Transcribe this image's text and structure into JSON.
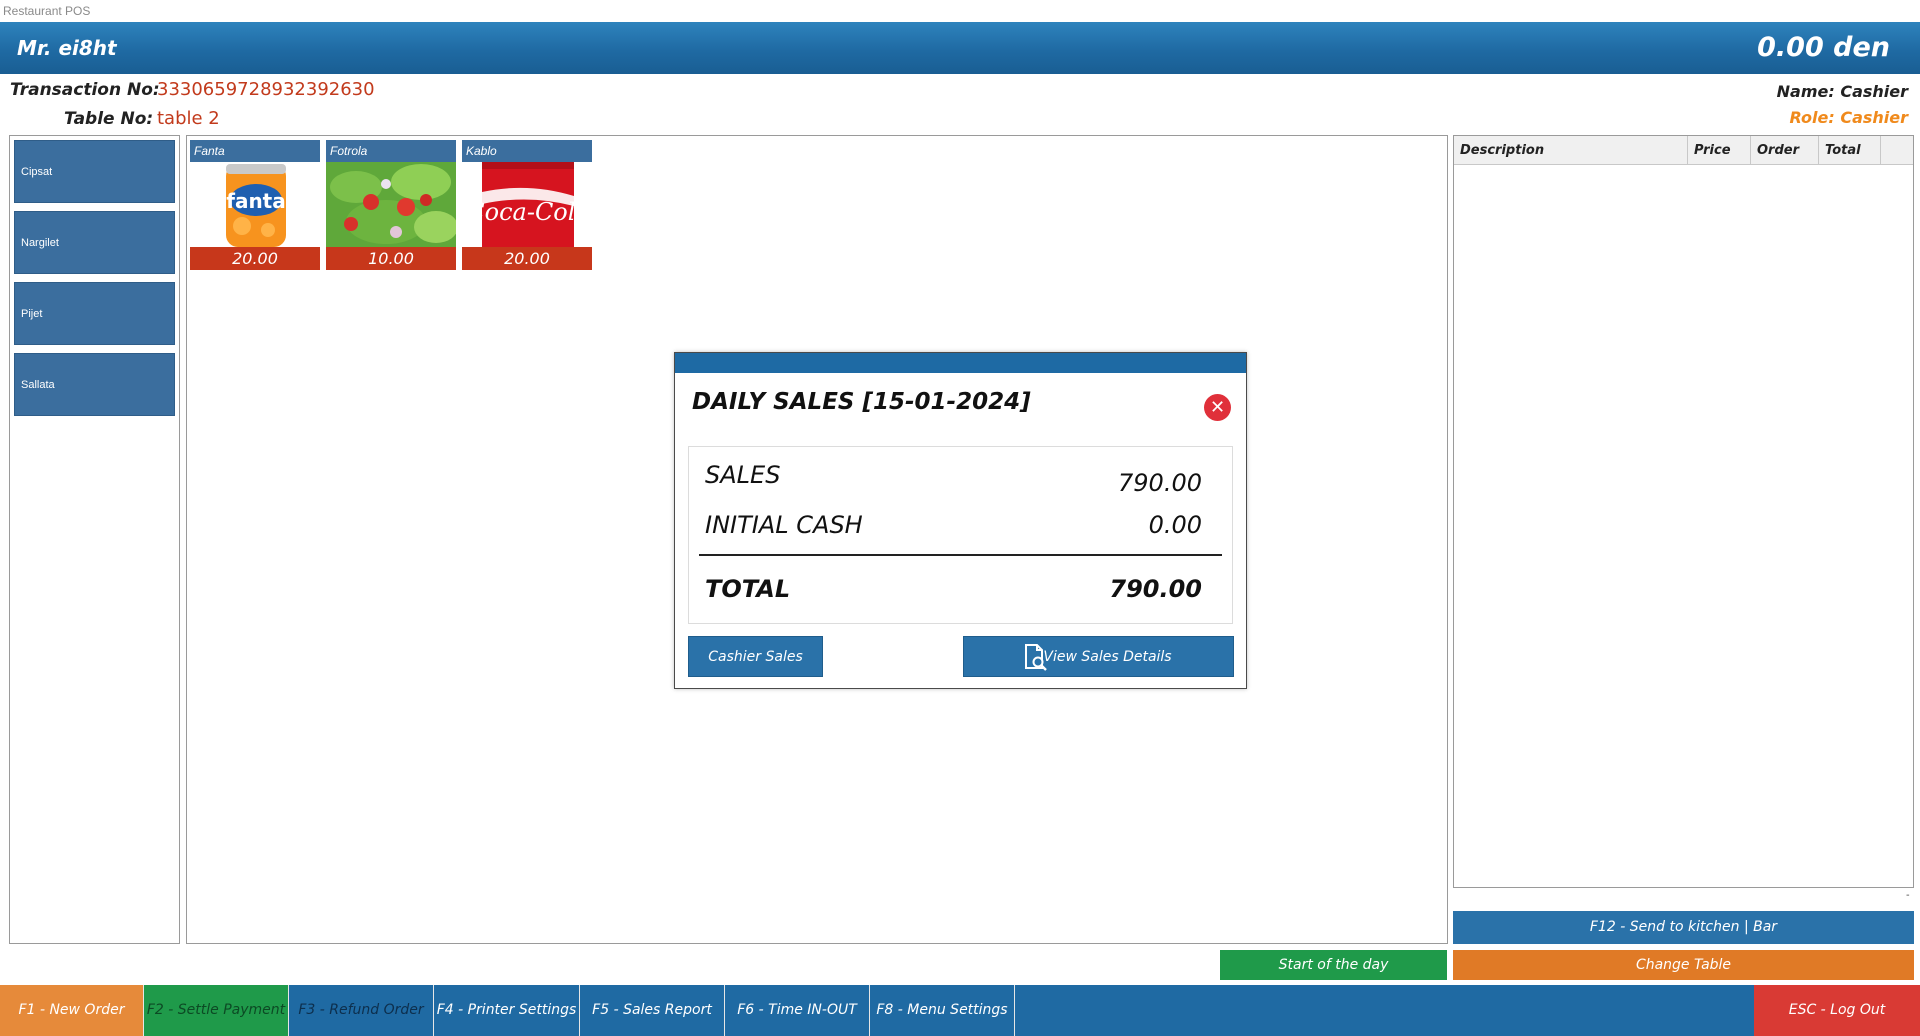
{
  "window": {
    "title": "Restaurant POS"
  },
  "header": {
    "user": "Mr. ei8ht",
    "balance": "0.00  den"
  },
  "transaction": {
    "transaction_label": "Transaction No:",
    "transaction_value": "3330659728932392630",
    "table_label": "Table No:",
    "table_value": "table 2",
    "name": "Name: Cashier",
    "role": "Role: Cashier"
  },
  "colors": {
    "accent": "#1f6aa3",
    "price_red": "#c7371b",
    "green": "#1f9a4a",
    "orange": "#e07a26",
    "logout_red": "#d93a34"
  },
  "categories": [
    {
      "label": "Cipsat"
    },
    {
      "label": "Nargilet"
    },
    {
      "label": "Pijet"
    },
    {
      "label": "Sallata"
    }
  ],
  "products": [
    {
      "name": "Fanta",
      "price": "20.00",
      "image": "fanta-can-image"
    },
    {
      "name": "Fotrola",
      "price": "10.00",
      "image": "salad-image"
    },
    {
      "name": "Kablo",
      "price": "20.00",
      "image": "coca-cola-can-image"
    }
  ],
  "order": {
    "columns": [
      "Description",
      "Price",
      "Order",
      "Total"
    ],
    "rows": [],
    "footer_mark": "-"
  },
  "actions": {
    "send_kitchen": "F12 - Send to kitchen | Bar",
    "start_day": "Start of the day",
    "change_table": "Change Table"
  },
  "fkeys": [
    {
      "label": "F1 - New Order"
    },
    {
      "label": "F2 - Settle Payment"
    },
    {
      "label": "F3 - Refund Order"
    },
    {
      "label": "F4 - Printer Settings"
    },
    {
      "label": "F5 - Sales Report"
    },
    {
      "label": "F6 - Time IN-OUT"
    },
    {
      "label": "F8 - Menu Settings"
    },
    {
      "label": "ESC - Log Out"
    }
  ],
  "dialog": {
    "title": "DAILY SALES [15-01-2024]",
    "close_icon": "close-circle-icon",
    "sales_label": "SALES",
    "sales_value": "790.00",
    "initial_cash_label": "INITIAL CASH",
    "initial_cash_value": "0.00",
    "total_label": "TOTAL",
    "total_value": "790.00",
    "cashier_sales_button": "Cashier Sales",
    "view_details_button": "View Sales Details",
    "view_details_icon": "document-search-icon"
  }
}
